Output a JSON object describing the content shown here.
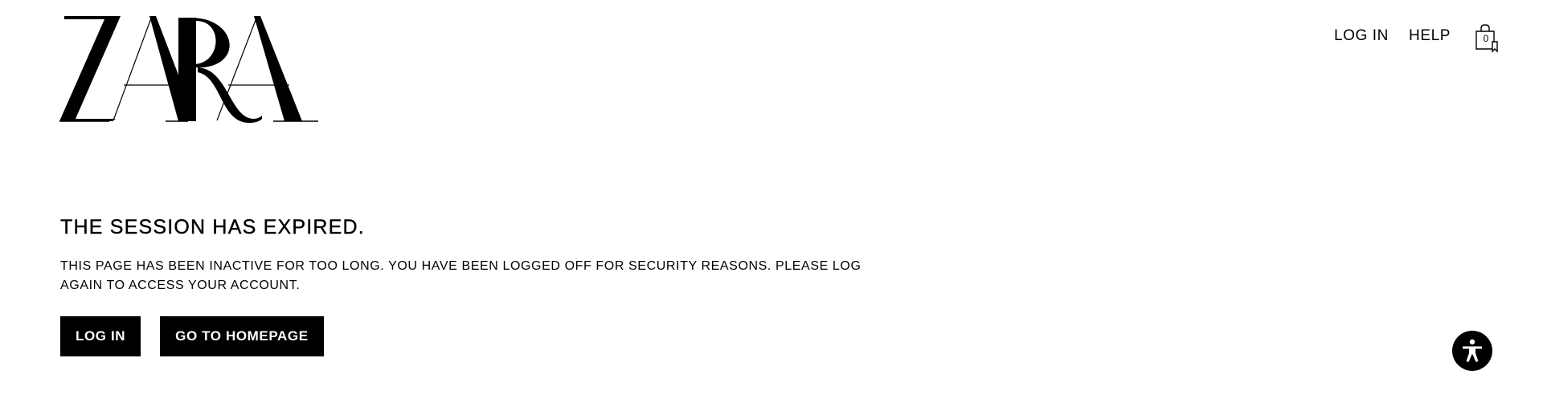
{
  "brand": {
    "logo_text": "ZARA"
  },
  "header": {
    "nav": {
      "login_label": "LOG IN",
      "help_label": "HELP"
    },
    "cart": {
      "count": "0",
      "icon": "shopping-bag-icon"
    }
  },
  "main": {
    "title": "THE SESSION HAS EXPIRED.",
    "message": "THIS PAGE HAS BEEN INACTIVE FOR TOO LONG. YOU HAVE BEEN LOGGED OFF FOR SECURITY REASONS. PLEASE LOG AGAIN TO ACCESS YOUR ACCOUNT.",
    "buttons": {
      "login_label": "LOG IN",
      "homepage_label": "GO TO HOMEPAGE"
    }
  },
  "accessibility": {
    "icon": "accessibility-icon"
  },
  "colors": {
    "text": "#000000",
    "background": "#ffffff",
    "button_bg": "#000000",
    "button_text": "#ffffff"
  }
}
